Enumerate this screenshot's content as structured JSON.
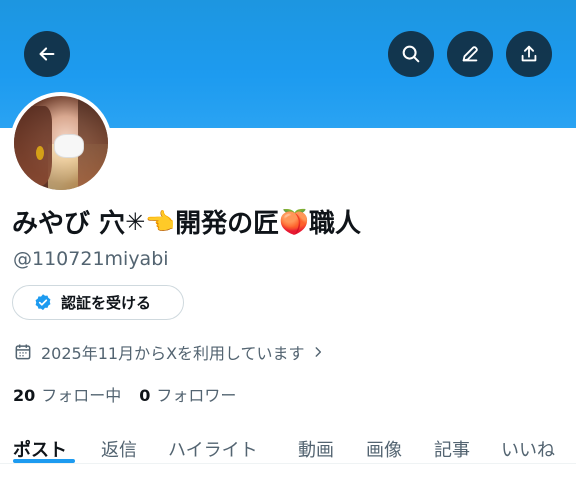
{
  "header": {
    "banner_color": "#1d9bf0",
    "back_icon": "arrow-left-icon",
    "search_icon": "search-icon",
    "edit_icon": "pencil-icon",
    "share_icon": "share-icon"
  },
  "profile": {
    "display_name_parts": {
      "a": "みやび 穴",
      "emoji1": "✳",
      "emoji2": "👈",
      "b": "開発の匠",
      "emoji3": "🍑",
      "c": "職人"
    },
    "handle": "@110721miyabi",
    "verify_button_label": "認証を受ける",
    "verify_badge_color": "#1d9bf0",
    "joined_text": "2025年11月からXを利用しています",
    "following_count": "20",
    "following_label": "フォロー中",
    "followers_count": "0",
    "followers_label": "フォロワー"
  },
  "tabs": {
    "items": [
      {
        "label": "ポスト",
        "active": true
      },
      {
        "label": "返信",
        "active": false
      },
      {
        "label": "ハイライト",
        "active": false
      },
      {
        "label": "動画",
        "active": false
      },
      {
        "label": "画像",
        "active": false
      },
      {
        "label": "記事",
        "active": false
      },
      {
        "label": "いいね",
        "active": false
      }
    ],
    "accent_color": "#1d9bf0"
  }
}
